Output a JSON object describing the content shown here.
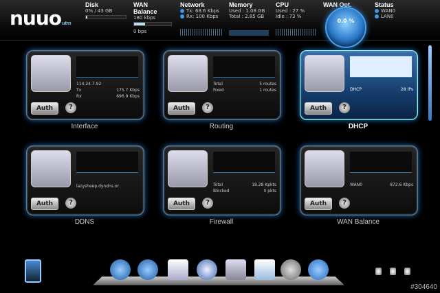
{
  "brand": {
    "logo": "nuuo",
    "suffix": "utm"
  },
  "header": {
    "disk": {
      "title": "Disk",
      "value": "0% / 43 GB",
      "fill": 0.02
    },
    "wan_balance": {
      "title": "WAN Balance",
      "value": "180 kbps",
      "sub": "0 bps"
    },
    "network": {
      "title": "Network",
      "tx_label": "Tx:",
      "tx": "68.6 Kbps",
      "rx_label": "Rx:",
      "rx": "100 Kbps"
    },
    "memory": {
      "title": "Memory",
      "used_label": "Used :",
      "used": "1.08 GB",
      "total_label": "Total :",
      "total": "2.85 GB"
    },
    "cpu": {
      "title": "CPU",
      "used_label": "Used :",
      "used": "27 %",
      "idle_label": "Idle :",
      "idle": "73 %"
    },
    "wan_opt": {
      "title": "WAN Opt.",
      "gauge": "0.0 %"
    },
    "status": {
      "title": "Status",
      "items": [
        "WAN0",
        "LAN0"
      ]
    }
  },
  "tiles": [
    {
      "label": "Interface",
      "auth": "Auth",
      "help": "?",
      "lines": [
        [
          "114.24.7.92",
          ""
        ],
        [
          "Tx",
          "175.7 Kbps"
        ],
        [
          "Rx",
          "696.9 Kbps"
        ]
      ]
    },
    {
      "label": "Routing",
      "auth": "Auth",
      "help": "?",
      "lines": [
        [
          "Total",
          "5 routes"
        ],
        [
          "Fixed",
          "1 routes"
        ]
      ]
    },
    {
      "label": "DHCP",
      "auth": "Auth",
      "help": "?",
      "lines": [
        [
          "DHCP",
          "28 IPs"
        ]
      ]
    },
    {
      "label": "DDNS",
      "auth": "Auth",
      "help": "?",
      "lines": [
        [
          "lazysheep.dyndns.or",
          ""
        ]
      ]
    },
    {
      "label": "Firewall",
      "auth": "Auth",
      "help": "?",
      "lines": [
        [
          "Total",
          "18.28 Kpkts"
        ],
        [
          "Blocked",
          "0 pkts"
        ]
      ]
    },
    {
      "label": "WAN Balance",
      "auth": "Auth",
      "help": "?",
      "lines": [
        [
          "WAN0",
          "872.6 Kbps"
        ]
      ]
    }
  ],
  "dock": {
    "items": [
      "web-icon",
      "shield-globe-icon",
      "security-badge-icon",
      "wireless-icon",
      "tools-icon",
      "report-icon",
      "settings-gears-icon",
      "user-puzzle-icon"
    ]
  },
  "watermark": "#304640",
  "colors": {
    "accent": "#2a7ad0",
    "glow": "#1d6ec0"
  }
}
